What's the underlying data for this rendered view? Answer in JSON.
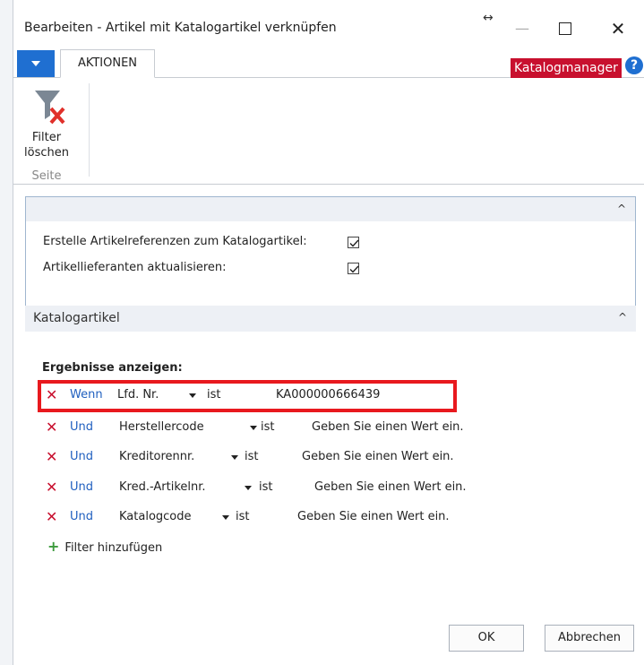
{
  "window": {
    "title": "Bearbeiten - Artikel mit Katalogartikel verknüpfen",
    "controls": {
      "resize": "↔",
      "minimize": "—",
      "maximize": "",
      "close": "✕"
    }
  },
  "ribbon": {
    "tab_label": "AKTIONEN",
    "catalog_manager": "Katalogmanager",
    "help": "?",
    "filter_clear_label_1": "Filter",
    "filter_clear_label_2": "löschen",
    "group_label": "Seite"
  },
  "options": {
    "row1_label": "Erstelle Artikelreferenzen zum Katalogartikel:",
    "row1_checked": true,
    "row2_label": "Artikellieferanten aktualisieren:",
    "row2_checked": true
  },
  "section2": {
    "title": "Katalogartikel"
  },
  "filters": {
    "title": "Ergebnisse anzeigen:",
    "rows": [
      {
        "conj": "Wenn",
        "field": "Lfd. Nr.",
        "op": "ist",
        "value": "KA000000666439"
      },
      {
        "conj": "Und",
        "field": "Herstellercode",
        "op": "ist",
        "value": "Geben Sie einen Wert ein."
      },
      {
        "conj": "Und",
        "field": "Kreditorennr.",
        "op": "ist",
        "value": "Geben Sie einen Wert ein."
      },
      {
        "conj": "Und",
        "field": "Kred.-Artikelnr.",
        "op": "ist",
        "value": "Geben Sie einen Wert ein."
      },
      {
        "conj": "Und",
        "field": "Katalogcode",
        "op": "ist",
        "value": "Geben Sie einen Wert ein."
      }
    ],
    "add_filter": "Filter hinzufügen"
  },
  "buttons": {
    "ok": "OK",
    "cancel": "Abbrechen"
  },
  "colors": {
    "accent": "#1f6fd1",
    "brand_red": "#c8102e",
    "highlight_red": "#e8191e"
  },
  "icons": [
    "filter-clear-icon",
    "remove-filter-icon",
    "add-filter-icon",
    "checkbox-checked-icon",
    "collapse-icon",
    "dropdown-arrow-icon"
  ]
}
